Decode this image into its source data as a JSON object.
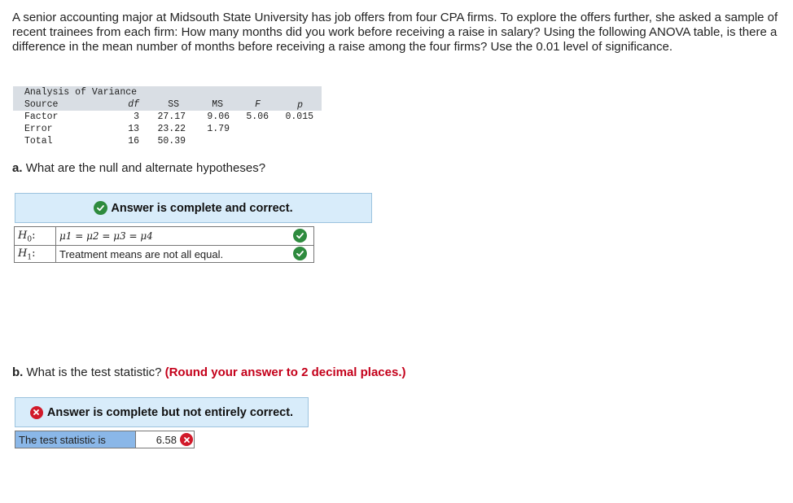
{
  "problem": {
    "text": "A senior accounting major at Midsouth State University has job offers from four CPA firms. To explore the offers further, she asked a sample of recent trainees from each firm: How many months did you work before receiving a raise in salary? Using the following ANOVA table, is there a difference in the mean number of months before receiving a raise among the four firms? Use the 0.01 level of significance."
  },
  "anova": {
    "title": "Analysis of Variance",
    "headers": {
      "source": "Source",
      "df": "df",
      "ss": "SS",
      "ms": "MS",
      "f": "F",
      "p": "p"
    },
    "rows": [
      {
        "source": "Factor",
        "df": "3",
        "ss": "27.17",
        "ms": "9.06",
        "f": "5.06",
        "p": "0.015"
      },
      {
        "source": "Error",
        "df": "13",
        "ss": "23.22",
        "ms": "1.79",
        "f": "",
        "p": ""
      },
      {
        "source": "Total",
        "df": "16",
        "ss": "50.39",
        "ms": "",
        "f": "",
        "p": ""
      }
    ]
  },
  "part_a": {
    "label": "a.",
    "question": "What are the null and alternate hypotheses?",
    "banner": "Answer is complete and correct.",
    "h0_label": "H",
    "h0_sub": "0",
    "h0_value": "μ1 = μ2 = μ3 = μ4",
    "h1_label": "H",
    "h1_sub": "1",
    "h1_value": "Treatment means are not all equal."
  },
  "part_b": {
    "label": "b.",
    "question": "What is the test statistic?",
    "instruction": "(Round your answer to 2 decimal places.)",
    "banner": "Answer is complete but not entirely correct.",
    "stat_label": "The test statistic is",
    "stat_value": "6.58"
  },
  "colors": {
    "correct_green": "#2e8b3e",
    "incorrect_red": "#d11a2a",
    "banner_bg": "#d8ecfa",
    "label_cell_bg": "#8ab7e8",
    "instruction_red": "#c4001a"
  },
  "icons": {
    "correct": "check-circle-icon",
    "incorrect": "x-circle-icon"
  }
}
